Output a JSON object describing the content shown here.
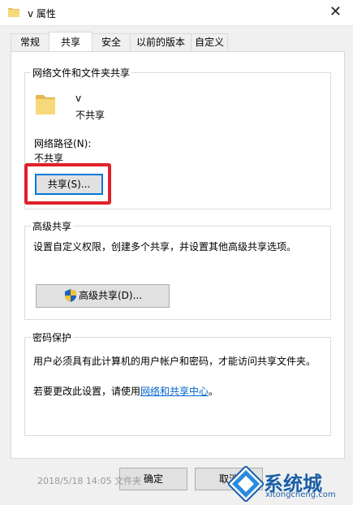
{
  "window": {
    "title": "v 属性"
  },
  "tabs": [
    {
      "label": "常规"
    },
    {
      "label": "共享"
    },
    {
      "label": "安全"
    },
    {
      "label": "以前的版本"
    },
    {
      "label": "自定义"
    }
  ],
  "network_sharing": {
    "legend": "网络文件和文件夹共享",
    "folder_name": "v",
    "folder_status": "不共享",
    "path_label": "网络路径(N):",
    "path_value": "不共享",
    "share_button": "共享(S)..."
  },
  "advanced_sharing": {
    "legend": "高级共享",
    "description": "设置自定义权限，创建多个共享，并设置其他高级共享选项。",
    "button": "高级共享(D)..."
  },
  "password_protection": {
    "legend": "密码保护",
    "description": "用户必须具有此计算机的用户帐户和密码，才能访问共享文件夹。",
    "change_prefix": "若要更改此设置，请使用",
    "change_link": "网络和共享中心",
    "change_suffix": "。"
  },
  "footer": {
    "ok_button": "确定",
    "cancel_button": "取消"
  },
  "background_fragment": "2018/5/18 14:05      文件夹",
  "watermark": {
    "brand": "系统城",
    "url": "xitongcheng.com"
  },
  "colors": {
    "highlight": "#e0202a",
    "link": "#0066cc",
    "focus": "#0078d7"
  }
}
